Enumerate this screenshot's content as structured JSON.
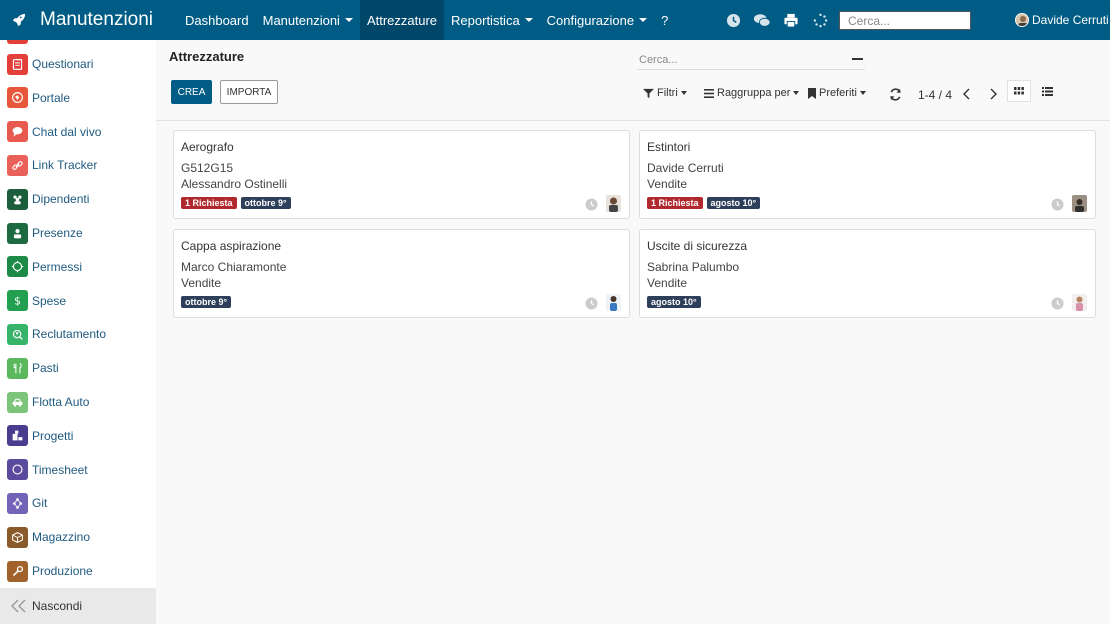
{
  "app": {
    "name": "Manutenzioni",
    "top_menu": [
      "Dashboard",
      "Manutenzioni",
      "Attrezzature",
      "Reportistica",
      "Configurazione",
      "?"
    ],
    "search_placeholder": "Cerca...",
    "user_name": "Davide Cerruti"
  },
  "sidebar": {
    "items": [
      {
        "label": "Questionari",
        "color": "#e3403a"
      },
      {
        "label": "Portale",
        "color": "#e8573c"
      },
      {
        "label": "Chat dal vivo",
        "color": "#e85a4f"
      },
      {
        "label": "Link Tracker",
        "color": "#ea6159"
      },
      {
        "label": "Dipendenti",
        "color": "#1c5e3b"
      },
      {
        "label": "Presenze",
        "color": "#1c6b40"
      },
      {
        "label": "Permessi",
        "color": "#1e8a47"
      },
      {
        "label": "Spese",
        "color": "#23a04f"
      },
      {
        "label": "Reclutamento",
        "color": "#38b36a"
      },
      {
        "label": "Pasti",
        "color": "#5cb85c"
      },
      {
        "label": "Flotta Auto",
        "color": "#7cc47a"
      },
      {
        "label": "Progetti",
        "color": "#4a3d8f"
      },
      {
        "label": "Timesheet",
        "color": "#5b4b9e"
      },
      {
        "label": "Git",
        "color": "#7262b8"
      },
      {
        "label": "Magazzino",
        "color": "#8a5a2b"
      },
      {
        "label": "Produzione",
        "color": "#a2622c"
      }
    ],
    "footer_label": "Nascondi"
  },
  "control_panel": {
    "title": "Attrezzature",
    "create_label": "CREA",
    "import_label": "IMPORTA",
    "search_placeholder": "Cerca...",
    "filters_label": "Filtri",
    "groupby_label": "Raggruppa per",
    "favorites_label": "Preferiti",
    "pager": "1-4 / 4"
  },
  "cards": [
    {
      "title": "Aerografo",
      "line1": "G512G15",
      "line2": "Alessandro Ostinelli",
      "tags": [
        {
          "text": "1 Richiesta",
          "kind": "red"
        },
        {
          "text": "ottobre 9°",
          "kind": "dark"
        }
      ]
    },
    {
      "title": "Estintori",
      "line1": "Davide Cerruti",
      "line2": "Vendite",
      "tags": [
        {
          "text": "1 Richiesta",
          "kind": "red"
        },
        {
          "text": "agosto 10°",
          "kind": "dark"
        }
      ]
    },
    {
      "title": "Cappa aspirazione",
      "line1": "Marco Chiaramonte",
      "line2": "Vendite",
      "tags": [
        {
          "text": "ottobre 9°",
          "kind": "dark"
        }
      ]
    },
    {
      "title": "Uscite di sicurezza",
      "line1": "Sabrina Palumbo",
      "line2": "Vendite",
      "tags": [
        {
          "text": "agosto 10°",
          "kind": "dark"
        }
      ]
    }
  ]
}
